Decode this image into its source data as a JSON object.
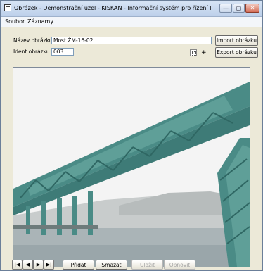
{
  "window": {
    "title": "Obrázek - Demonstrační uzel - KISKAN - Informační systém pro řízení krizových...",
    "controls": {
      "minimize": "—",
      "maximize": "▢",
      "close": "✕"
    }
  },
  "menu": {
    "items": [
      "Soubor",
      "Záznamy"
    ]
  },
  "form": {
    "name_label": "Název obrázku:",
    "name_value": "Most ŽM-16-02",
    "ident_label": "Ident obrázku:",
    "ident_value": "003",
    "plus": "+"
  },
  "buttons": {
    "import": "Import obrázku",
    "export": "Export obrázku",
    "add": "Přidat",
    "delete": "Smazat",
    "save": "Uložit",
    "revert": "Obnovit"
  },
  "nav": {
    "first": "|◀",
    "prev": "◀",
    "next": "▶",
    "last": "▶|"
  },
  "icons": {
    "app": "window-app-icon",
    "picture_tool": "small-frame-icon"
  },
  "colors": {
    "bridge": "#4a8b86",
    "sky": "#f4f4f4",
    "water": "#aab4b7",
    "hill": "#c8cccc"
  }
}
